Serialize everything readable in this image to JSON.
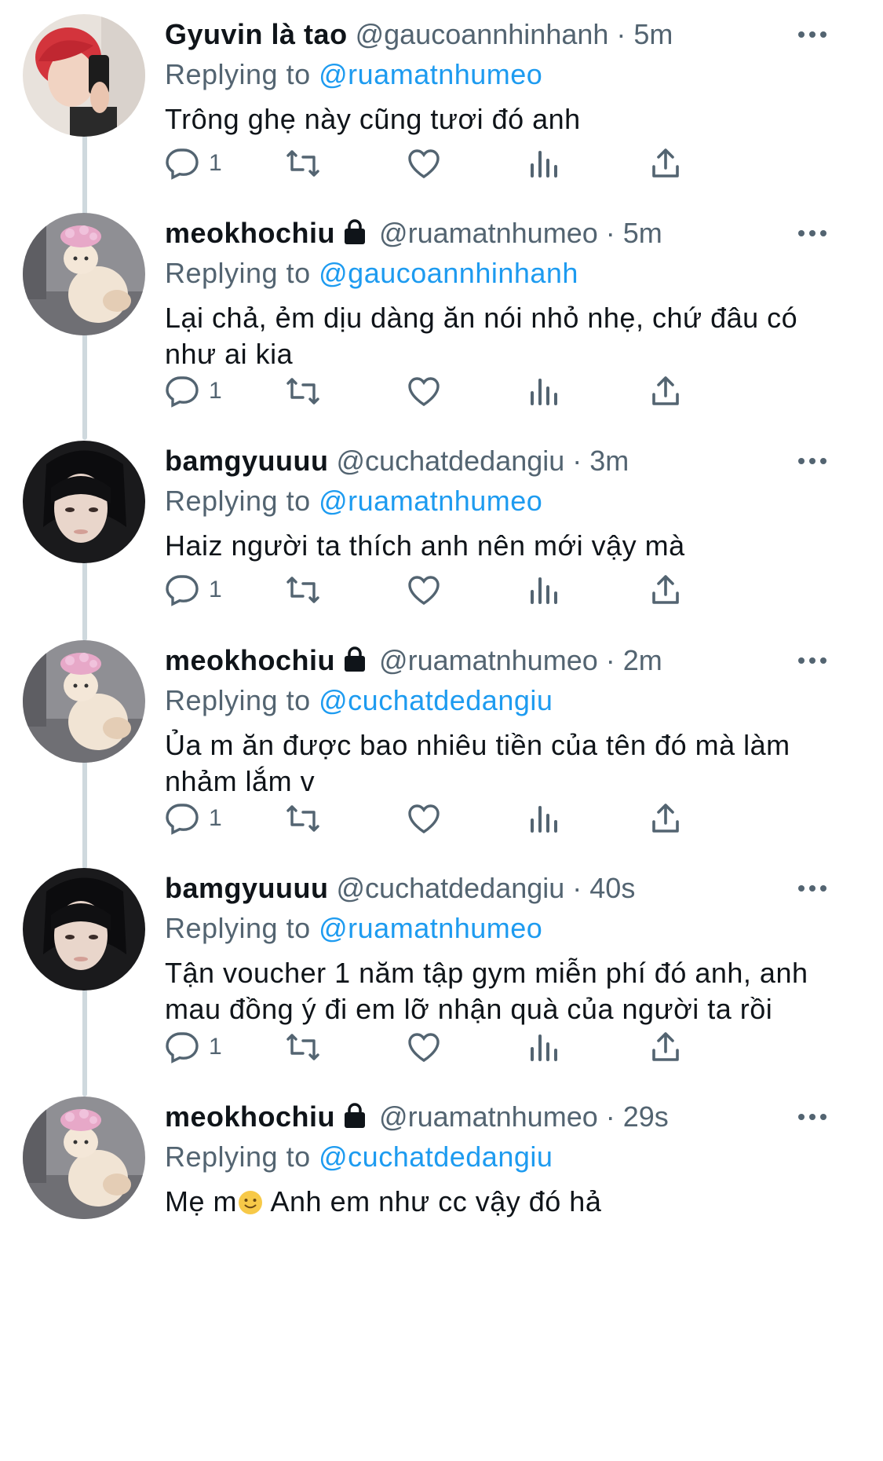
{
  "tweets": [
    {
      "name": "Gyuvin là tao",
      "locked": false,
      "handle": "@gaucoannhinhanh",
      "time": "5m",
      "replying_label": "Replying to",
      "replying_to": "@ruamatnhumeo",
      "text": "Trông ghẹ này cũng tươi đó anh",
      "reply_count": "1",
      "avatar": "red-hair-selfie-avatar"
    },
    {
      "name": "meokhochiu",
      "locked": true,
      "handle": "@ruamatnhumeo",
      "time": "5m",
      "replying_label": "Replying to",
      "replying_to": "@gaucoannhinhanh",
      "text_lines": [
        "Lại chả, ẻm dịu dàng ăn nói nhỏ nhẹ, chứ đâu có",
        "như ai kia"
      ],
      "reply_count": "1",
      "avatar": "cat-with-pink-hat-avatar"
    },
    {
      "name": "bamgyuuuu",
      "locked": false,
      "handle": "@cuchatdedangiu",
      "time": "3m",
      "replying_label": "Replying to",
      "replying_to": "@ruamatnhumeo",
      "text": "Haiz người ta thích anh nên mới vậy mà",
      "reply_count": "1",
      "avatar": "dark-portrait-avatar"
    },
    {
      "name": "meokhochiu",
      "locked": true,
      "handle": "@ruamatnhumeo",
      "time": "2m",
      "replying_label": "Replying to",
      "replying_to": "@cuchatdedangiu",
      "text_lines": [
        "Ủa m ăn được bao nhiêu tiền của tên đó mà làm",
        "nhảm lắm v"
      ],
      "reply_count": "1",
      "avatar": "cat-with-pink-hat-avatar"
    },
    {
      "name": "bamgyuuuu",
      "locked": false,
      "handle": "@cuchatdedangiu",
      "time": "40s",
      "replying_label": "Replying to",
      "replying_to": "@ruamatnhumeo",
      "text_lines": [
        "Tận voucher 1 năm tập gym miễn phí đó anh, anh",
        "mau đồng ý đi em lỡ nhận quà của người ta rồi"
      ],
      "reply_count": "1",
      "avatar": "dark-portrait-avatar"
    },
    {
      "name": "meokhochiu",
      "locked": true,
      "handle": "@ruamatnhumeo",
      "time": "29s",
      "replying_label": "Replying to",
      "replying_to": "@cuchatdedangiu",
      "text_before_emoji": "Mẹ m",
      "emoji": "slightly-smiling-face-emoji",
      "text_after_emoji": " Anh em như cc vậy đó hả",
      "avatar": "cat-with-pink-hat-avatar"
    }
  ],
  "colors": {
    "link": "#1d9bf0",
    "muted": "#536471",
    "thread_line": "#cfd9de"
  }
}
